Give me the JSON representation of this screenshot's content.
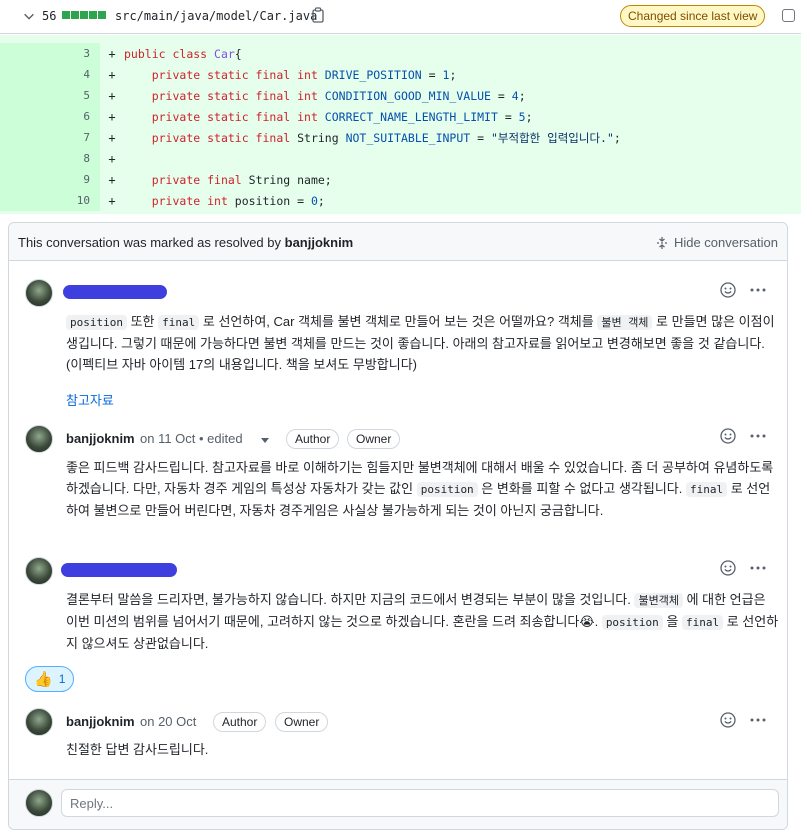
{
  "file": {
    "change_count": "56",
    "path": "src/main/java/model/Car.java",
    "changed_badge": "Changed since last view"
  },
  "diff": {
    "lines": [
      {
        "num": "3",
        "tokens": [
          [
            "kw",
            "public "
          ],
          [
            "kw",
            "class "
          ],
          [
            "cls",
            "Car"
          ],
          [
            "",
            "{"
          ]
        ]
      },
      {
        "num": "4",
        "tokens": [
          [
            "",
            "    "
          ],
          [
            "kw",
            "private static final int "
          ],
          [
            "cst",
            "DRIVE_POSITION"
          ],
          [
            "",
            " = "
          ],
          [
            "num",
            "1"
          ],
          [
            "",
            ";"
          ]
        ]
      },
      {
        "num": "5",
        "tokens": [
          [
            "",
            "    "
          ],
          [
            "kw",
            "private static final int "
          ],
          [
            "cst",
            "CONDITION_GOOD_MIN_VALUE"
          ],
          [
            "",
            " = "
          ],
          [
            "num",
            "4"
          ],
          [
            "",
            ";"
          ]
        ]
      },
      {
        "num": "6",
        "tokens": [
          [
            "",
            "    "
          ],
          [
            "kw",
            "private static final int "
          ],
          [
            "cst",
            "CORRECT_NAME_LENGTH_LIMIT"
          ],
          [
            "",
            " = "
          ],
          [
            "num",
            "5"
          ],
          [
            "",
            ";"
          ]
        ]
      },
      {
        "num": "7",
        "tokens": [
          [
            "",
            "    "
          ],
          [
            "kw",
            "private static final "
          ],
          [
            "",
            "String "
          ],
          [
            "cst",
            "NOT_SUITABLE_INPUT"
          ],
          [
            "",
            " = "
          ],
          [
            "str",
            "\"부적합한 입력입니다.\""
          ],
          [
            "",
            ";"
          ]
        ]
      },
      {
        "num": "8",
        "tokens": []
      },
      {
        "num": "9",
        "tokens": [
          [
            "",
            "    "
          ],
          [
            "kw",
            "private final "
          ],
          [
            "",
            "String name;"
          ]
        ]
      },
      {
        "num": "10",
        "tokens": [
          [
            "",
            "    "
          ],
          [
            "kw",
            "private int "
          ],
          [
            "",
            "position = "
          ],
          [
            "num",
            "0"
          ],
          [
            "",
            ";"
          ]
        ]
      }
    ]
  },
  "conversation": {
    "resolved_prefix": "This conversation was marked as resolved by ",
    "resolved_user": "banjjoknim",
    "hide_label": "Hide conversation",
    "comments": [
      {
        "author": "",
        "body_parts": [
          [
            "code",
            "position"
          ],
          [
            "text",
            " 또한 "
          ],
          [
            "code",
            "final"
          ],
          [
            "text",
            " 로 선언하여, Car 객체를 불변 객체로 만들어 보는 것은 어떨까요? 객체를 "
          ],
          [
            "code",
            "불변 객체"
          ],
          [
            "text",
            " 로 만들면 많은 이점이 생깁니다. 그렇기 때문에 가능하다면 불변 객체를 만드는 것이 좋습니다. 아래의 참고자료를 읽어보고 변경해보면 좋을 것 같습니다. (이펙티브 자바 아이템 17의 내용입니다. 책을 보셔도 무방합니다)"
          ]
        ],
        "link": "참고자료"
      },
      {
        "author": "banjjoknim",
        "meta": "on 11 Oct • edited",
        "badges": [
          "Author",
          "Owner"
        ],
        "body_parts": [
          [
            "text",
            "좋은 피드백 감사드립니다. 참고자료를 바로 이해하기는 힘들지만 불변객체에 대해서 배울 수 있었습니다. 좀 더 공부하여 유념하도록 하겠습니다. 다만, 자동차 경주 게임의 특성상 자동차가 갖는 값인 "
          ],
          [
            "code",
            "position"
          ],
          [
            "text",
            " 은 변화를 피할 수 없다고 생각됩니다. "
          ],
          [
            "code",
            "final"
          ],
          [
            "text",
            " 로 선언하여 불변으로 만들어 버린다면, 자동차 경주게임은 사실상 불가능하게 되는 것이 아닌지 궁금합니다."
          ]
        ]
      },
      {
        "author": "",
        "body_parts": [
          [
            "text",
            "결론부터 말씀을 드리자면, 불가능하지 않습니다. 하지만 지금의 코드에서 변경되는 부분이 많을 것입니다. "
          ],
          [
            "code",
            "불변객체"
          ],
          [
            "text",
            " 에 대한 언급은 이번 미션의 범위를 넘어서기 때문에, 고려하지 않는 것으로 하겠습니다. 혼란을 드려 죄송합니다😭. "
          ],
          [
            "code",
            "position"
          ],
          [
            "text",
            " 을 "
          ],
          [
            "code",
            "final"
          ],
          [
            "text",
            " 로 선언하지 않으셔도 상관없습니다."
          ]
        ],
        "reaction": {
          "emoji": "👍",
          "count": "1"
        }
      },
      {
        "author": "banjjoknim",
        "meta": "on 20 Oct",
        "badges": [
          "Author",
          "Owner"
        ],
        "body_parts": [
          [
            "text",
            "친절한 답변 감사드립니다."
          ]
        ]
      }
    ],
    "reply_placeholder": "Reply..."
  },
  "colors": {
    "added_bg": "#e6ffec",
    "added_num_bg": "#ccffd8",
    "redaction": "#3f3fe0",
    "badge_border": "#bf8700"
  },
  "icons": [
    "chevron-down-icon",
    "copy-icon",
    "unfold-icon",
    "smiley-icon",
    "kebab-icon",
    "thumbs-up-icon"
  ]
}
